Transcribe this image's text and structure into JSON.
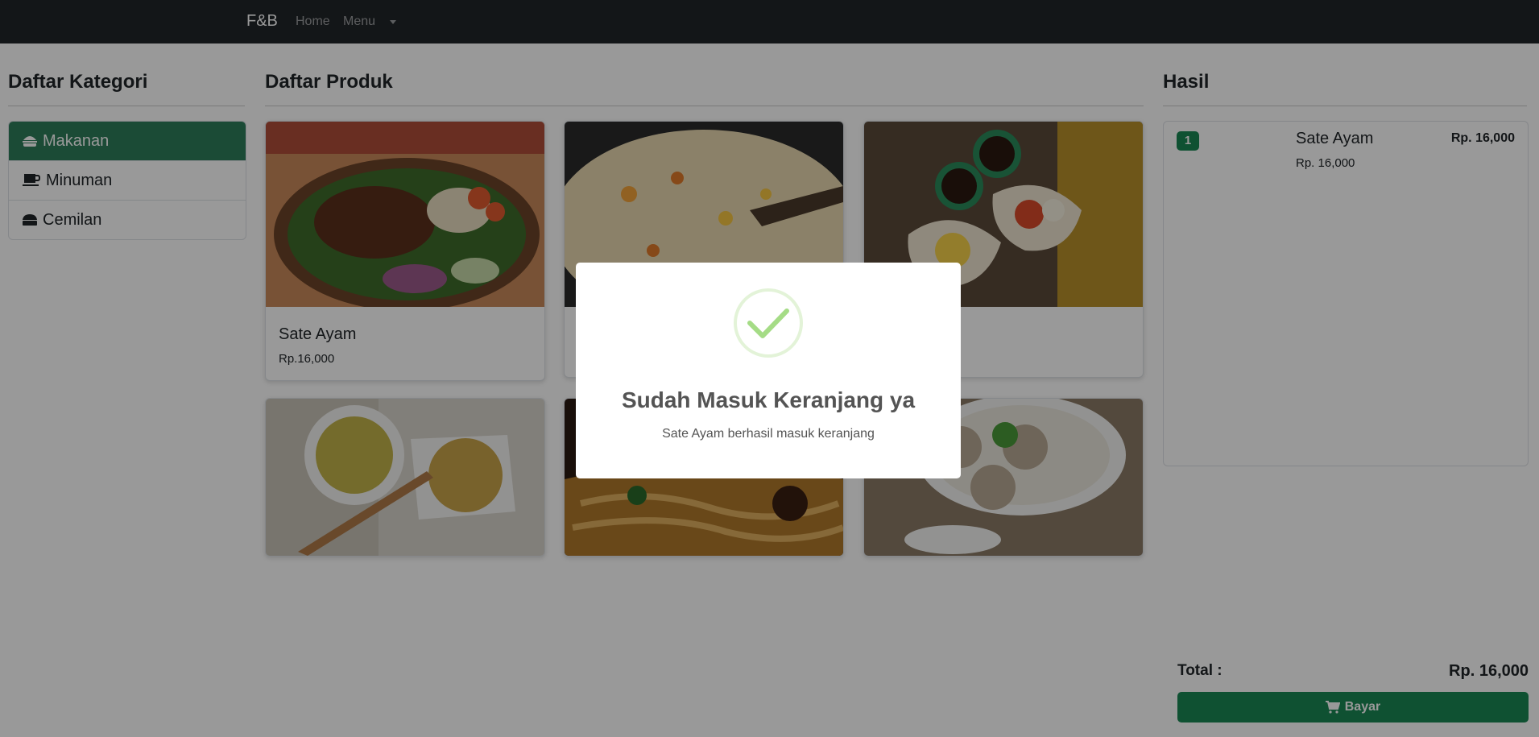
{
  "navbar": {
    "brand": "F&B",
    "home": "Home",
    "menu": "Menu"
  },
  "categories": {
    "heading": "Daftar Kategori",
    "items": [
      {
        "label": "Makanan",
        "icon": "hamburger-icon",
        "active": true
      },
      {
        "label": "Minuman",
        "icon": "coffee-icon",
        "active": false
      },
      {
        "label": "Cemilan",
        "icon": "cheese-icon",
        "active": false
      }
    ]
  },
  "products": {
    "heading": "Daftar Produk",
    "items": [
      {
        "name": "Sate Ayam",
        "price": "Rp.16,000"
      }
    ]
  },
  "result": {
    "heading": "Hasil",
    "items": [
      {
        "qty": "1",
        "name": "Sate Ayam",
        "unit_price": "Rp. 16,000",
        "total": "Rp. 16,000"
      }
    ],
    "total_label": "Total :",
    "total_value": "Rp. 16,000",
    "pay_label": "Bayar"
  },
  "modal": {
    "title": "Sudah Masuk Keranjang ya",
    "text": "Sate Ayam berhasil masuk keranjang",
    "icon": "success-check-icon"
  },
  "colors": {
    "accent": "#198754",
    "active_category": "#2e7d5b",
    "navbar": "#212529"
  }
}
